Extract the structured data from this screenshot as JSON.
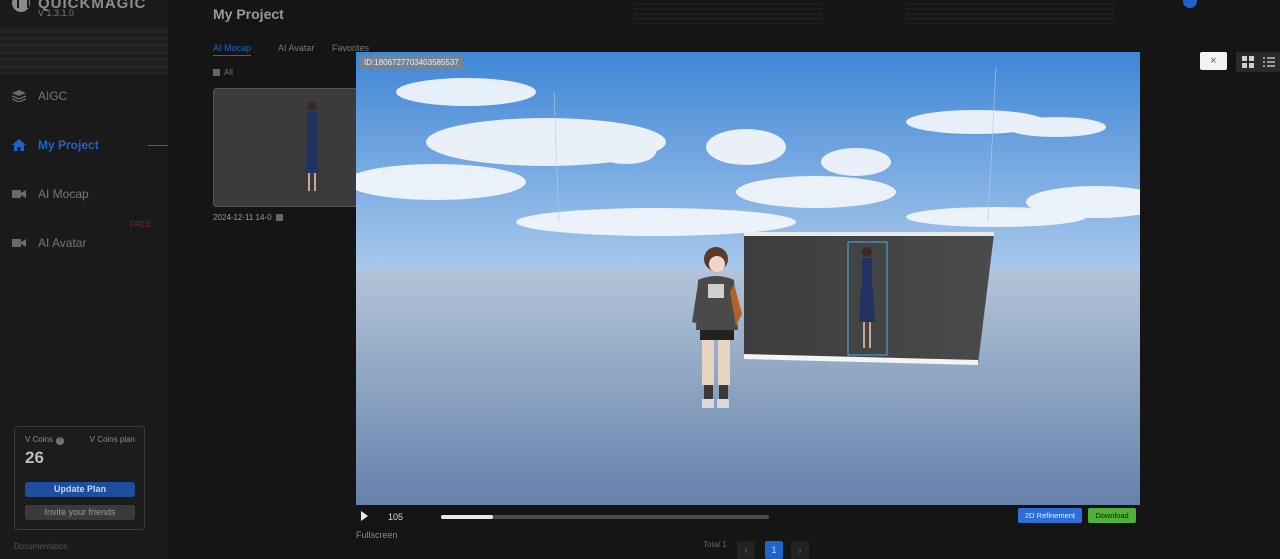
{
  "app": {
    "logo_text": "QUICKMAGIC",
    "version": "V 1.3.1.0"
  },
  "sidebar": {
    "items": [
      {
        "label": "AIGC",
        "icon": "layers-icon"
      },
      {
        "label": "My Project",
        "icon": "home-icon",
        "active": true
      },
      {
        "label": "AI Mocap",
        "icon": "video-camera-icon"
      },
      {
        "label": "AI Avatar",
        "icon": "video-camera-icon"
      }
    ],
    "free_badge": "FREE",
    "coins": {
      "label": "V Coins",
      "plan_label": "V Coins plan",
      "value": "26",
      "update_button": "Update Plan",
      "invite_button": "Invite your friends"
    },
    "documentation": "Documentation"
  },
  "main": {
    "title": "My Project",
    "tabs": [
      {
        "label": "AI Mocap",
        "active": true
      },
      {
        "label": "AI Avatar"
      },
      {
        "label": "Favorites"
      }
    ],
    "select_all": "All",
    "project_card": {
      "date": "2024-12-11 14-0"
    },
    "pager": {
      "total": "Total 1",
      "current": "1"
    }
  },
  "viewer": {
    "id_label": "ID:1806727703403585537",
    "frame": "105",
    "progress": 0.16,
    "refine_button": "2D Refinement",
    "download_button": "Download",
    "fullscreen": "Fullscreen",
    "close": "×"
  },
  "colors": {
    "accent": "#1f64c8",
    "download": "#4fb03a",
    "refine": "#2d6fd6",
    "free": "#8b1d1d"
  }
}
